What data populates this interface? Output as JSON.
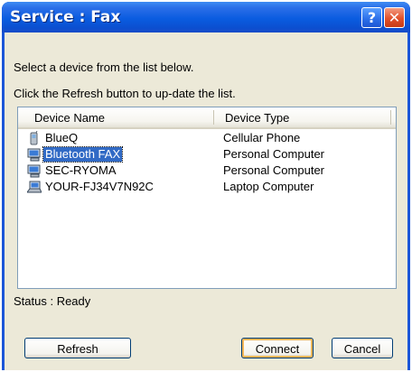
{
  "window": {
    "title": "Service : Fax"
  },
  "instructions": {
    "line1": "Select a device from the list below.",
    "line2": "Click the Refresh button to up-date the list."
  },
  "list": {
    "columns": [
      "Device Name",
      "Device Type"
    ],
    "rows": [
      {
        "name": "BlueQ",
        "type": "Cellular Phone",
        "icon": "cellphone-icon",
        "selected": false
      },
      {
        "name": "Bluetooth FAX",
        "type": "Personal Computer",
        "icon": "computer-icon",
        "selected": true
      },
      {
        "name": "SEC-RYOMA",
        "type": "Personal Computer",
        "icon": "computer-icon",
        "selected": false
      },
      {
        "name": "YOUR-FJ34V7N92C",
        "type": "Laptop Computer",
        "icon": "laptop-icon",
        "selected": false
      }
    ]
  },
  "status": "Status : Ready",
  "buttons": {
    "refresh": "Refresh",
    "connect": "Connect",
    "cancel": "Cancel"
  },
  "title_buttons": {
    "help": "?",
    "close": "✕"
  },
  "colors": {
    "titlebar": "#0b4fd0",
    "selection": "#316ac5",
    "dialog": "#ece9d8"
  }
}
